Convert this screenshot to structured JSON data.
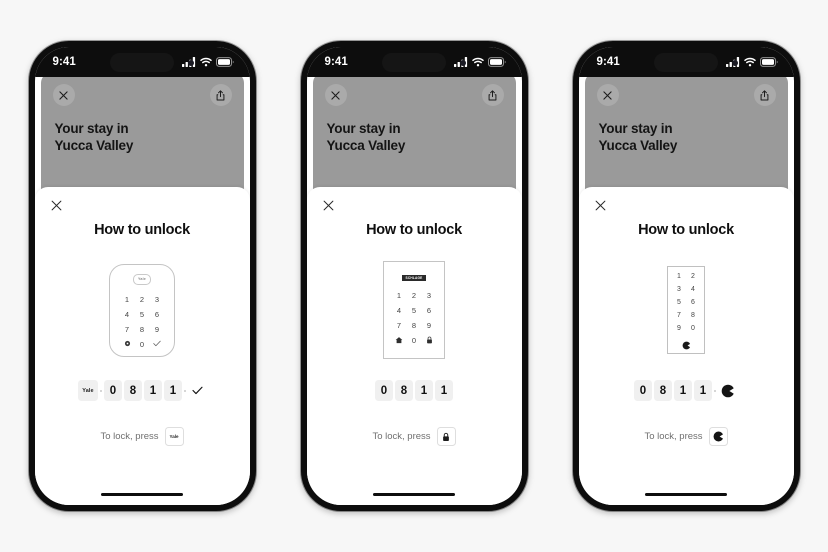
{
  "background_color": "#f7f7f7",
  "phones": [
    {
      "status_bar": {
        "time": "9:41",
        "icons": [
          "cellular-signal-icon",
          "wifi-icon",
          "battery-icon"
        ]
      },
      "header_card": {
        "close_label": "close-icon",
        "share_label": "share-icon",
        "title_line1": "Your stay in",
        "title_line2": "Yucca Valley",
        "background_color": "#9a9a9a"
      },
      "sheet": {
        "close_label": "close-icon",
        "title": "How to unlock",
        "lock": {
          "style": "yale",
          "brand": "Yale",
          "keys": [
            "1",
            "2",
            "3",
            "4",
            "5",
            "6",
            "7",
            "8",
            "9"
          ],
          "bottom_keys": [
            "gear-icon",
            "0",
            "check-icon"
          ]
        },
        "code": {
          "brand_badge": "Yale",
          "digits": [
            "0",
            "8",
            "1",
            "1"
          ],
          "trailing": "check-icon"
        },
        "lock_hint": {
          "text": "To lock, press",
          "badge": "Yale",
          "badge_icon": "yale-brand-icon"
        }
      }
    },
    {
      "status_bar": {
        "time": "9:41",
        "icons": [
          "cellular-signal-icon",
          "wifi-icon",
          "battery-icon"
        ]
      },
      "header_card": {
        "close_label": "close-icon",
        "share_label": "share-icon",
        "title_line1": "Your stay in",
        "title_line2": "Yucca Valley",
        "background_color": "#9a9a9a"
      },
      "sheet": {
        "close_label": "close-icon",
        "title": "How to unlock",
        "lock": {
          "style": "schlage",
          "brand": "SCHLAGE",
          "keys": [
            "1",
            "2",
            "3",
            "4",
            "5",
            "6",
            "7",
            "8",
            "9"
          ],
          "bottom_keys": [
            "home-icon",
            "0",
            "lock-icon"
          ]
        },
        "code": {
          "brand_badge": null,
          "digits": [
            "0",
            "8",
            "1",
            "1"
          ],
          "trailing": null
        },
        "lock_hint": {
          "text": "To lock, press",
          "badge": null,
          "badge_icon": "lock-icon"
        }
      }
    },
    {
      "status_bar": {
        "time": "9:41",
        "icons": [
          "cellular-signal-icon",
          "wifi-icon",
          "battery-icon"
        ]
      },
      "header_card": {
        "close_label": "close-icon",
        "share_label": "share-icon",
        "title_line1": "Your stay in",
        "title_line2": "Yucca Valley",
        "background_color": "#9a9a9a"
      },
      "sheet": {
        "close_label": "close-icon",
        "title": "How to unlock",
        "lock": {
          "style": "narrow",
          "brand": null,
          "keys": [
            "1",
            "2",
            "3",
            "4",
            "5",
            "6",
            "7",
            "8",
            "9",
            "0"
          ],
          "bottom_keys": [
            "brand-circle-icon"
          ]
        },
        "code": {
          "brand_badge": null,
          "digits": [
            "0",
            "8",
            "1",
            "1"
          ],
          "trailing": "brand-circle-icon"
        },
        "lock_hint": {
          "text": "To lock, press",
          "badge": null,
          "badge_icon": "brand-circle-icon"
        }
      }
    }
  ]
}
